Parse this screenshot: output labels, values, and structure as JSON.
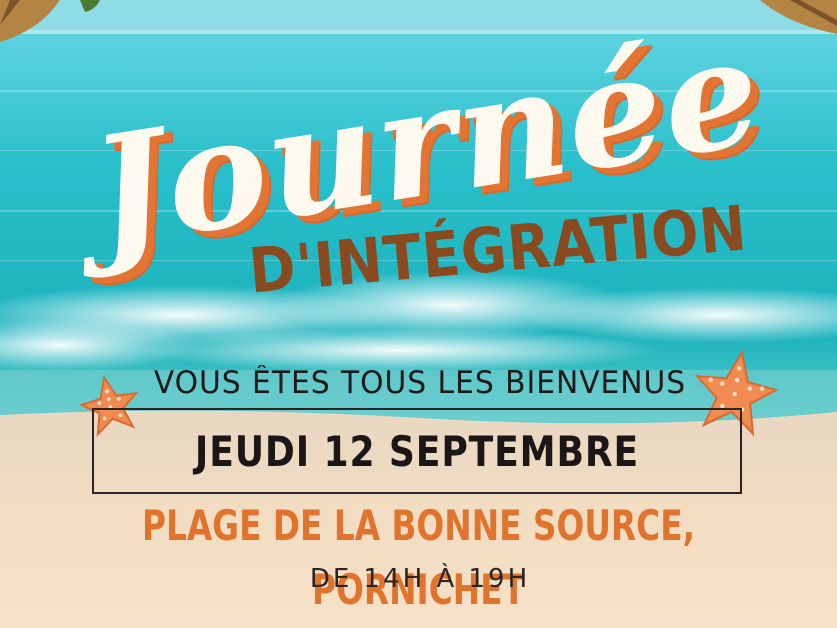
{
  "title": {
    "script": "Journée",
    "subtitle": "D'INTÉGRATION"
  },
  "welcome": "VOUS ÊTES TOUS LES BIENVENUS",
  "date": "JEUDI 12 SEPTEMBRE",
  "location": "PLAGE DE LA BONNE SOURCE, PORNICHET",
  "hours": "DE 14H À 19H",
  "colors": {
    "sky": "#4fc9db",
    "sea": "#1fb8c6",
    "foam": "#e9f7f7",
    "sand": "#f1dcc0",
    "accent_orange": "#e0742f",
    "brown": "#8a4a1f",
    "dark_text": "#1f1a1a"
  },
  "icons": [
    "starfish-icon",
    "palm-tree-icon"
  ]
}
